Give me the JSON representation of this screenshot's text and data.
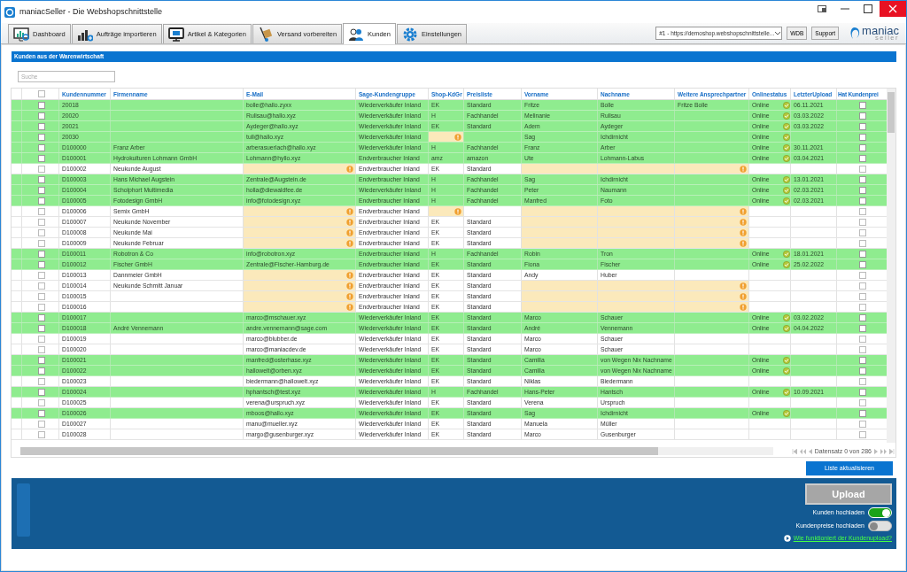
{
  "window": {
    "title": "maniacSeller - Die Webshopschnittstelle"
  },
  "tabs": [
    {
      "label": "Dashboard",
      "selected": false
    },
    {
      "label": "Aufträge importieren",
      "selected": false
    },
    {
      "label": "Artikel & Kategorien",
      "selected": false
    },
    {
      "label": "Versand vorbereiten",
      "selected": false
    },
    {
      "label": "Kunden",
      "selected": true
    },
    {
      "label": "Einstellungen",
      "selected": false
    }
  ],
  "shop_select": {
    "value": "#1 - https://demoshop.webshopschnittstelle..."
  },
  "header_buttons": [
    "WDB",
    "Support"
  ],
  "logo": {
    "name": "maniac",
    "tagline": "seller"
  },
  "section_title": "Kunden aus der Warenwirtschaft",
  "search": {
    "placeholder": "Suche"
  },
  "table": {
    "select_all_checked": false,
    "columns": [
      "Kundennummer",
      "Firmenname",
      "E-Mail",
      "Sage-Kundengruppe",
      "Shop-KdGr",
      "Preisliste",
      "Vorname",
      "Nachname",
      "Weitere Ansprechpartner",
      "Onlinestatus",
      "LetzterUpload",
      "Hat Kundenprei"
    ],
    "rows": [
      {
        "num": "20018",
        "firm": "",
        "email": "bolle@hallo.zyxx",
        "group": "Wiederverkäufer Inland",
        "shop": "EK",
        "price": "Standard",
        "first": "Fritze",
        "last": "Bolle",
        "contact": "Fritze Bolle",
        "online": "Online",
        "upload": "06.11.2021",
        "synced": true,
        "checked": false,
        "has_prices": false,
        "email_warning": false,
        "shop_warning": false,
        "contact_warning": false
      },
      {
        "num": "20020",
        "firm": "",
        "email": "Rulisau@hallo.xyz",
        "group": "Wiederverkäufer Inland",
        "shop": "H",
        "price": "Fachhandel",
        "first": "Melinanie",
        "last": "Rulisau",
        "contact": "",
        "online": "Online",
        "upload": "03.03.2022",
        "synced": true,
        "checked": false,
        "has_prices": false,
        "email_warning": false,
        "shop_warning": false,
        "contact_warning": false
      },
      {
        "num": "20021",
        "firm": "",
        "email": "Aydeger@hallo.xyz",
        "group": "Wiederverkäufer Inland",
        "shop": "EK",
        "price": "Standard",
        "first": "Adem",
        "last": "Aydeger",
        "contact": "",
        "online": "Online",
        "upload": "03.03.2022",
        "synced": true,
        "checked": false,
        "has_prices": false,
        "email_warning": false,
        "shop_warning": false,
        "contact_warning": false
      },
      {
        "num": "20030",
        "firm": "",
        "email": "tull@hallo.xyz",
        "group": "Wiederverkäufer Inland",
        "shop": "",
        "price": "",
        "first": "Sag",
        "last": "Ichdirnicht",
        "contact": "",
        "online": "Online",
        "upload": "",
        "synced": true,
        "checked": false,
        "has_prices": false,
        "email_warning": false,
        "shop_warning": true,
        "contact_warning": false
      },
      {
        "num": "D100000",
        "firm": "Franz Arber",
        "email": "arberasuerlach@hallo.xyz",
        "group": "Wiederverkäufer Inland",
        "shop": "H",
        "price": "Fachhandel",
        "first": "Franz",
        "last": "Arber",
        "contact": "",
        "online": "Online",
        "upload": "30.11.2021",
        "synced": true,
        "checked": false,
        "has_prices": false,
        "email_warning": false,
        "shop_warning": false,
        "contact_warning": false
      },
      {
        "num": "D100001",
        "firm": "Hydrokulturen Lohmann GmbH",
        "email": "Lohmann@hyllo.xyz",
        "group": "Endverbraucher Inland",
        "shop": "amz",
        "price": "amazon",
        "first": "Ute",
        "last": "Lohmann-Labus",
        "contact": "",
        "online": "Online",
        "upload": "03.04.2021",
        "synced": true,
        "checked": false,
        "has_prices": false,
        "email_warning": false,
        "shop_warning": false,
        "contact_warning": false
      },
      {
        "num": "D100002",
        "firm": "Neukunde August",
        "email": "",
        "group": "Endverbraucher Inland",
        "shop": "EK",
        "price": "Standard",
        "first": "",
        "last": "",
        "contact": "",
        "online": "",
        "upload": "",
        "synced": false,
        "checked": false,
        "has_prices": false,
        "email_warning": true,
        "shop_warning": false,
        "contact_warning": true
      },
      {
        "num": "D100003",
        "firm": "Hans Michael Augstein",
        "email": "Zentrale@Augstein.de",
        "group": "Endverbraucher Inland",
        "shop": "H",
        "price": "Fachhandel",
        "first": "Sag",
        "last": "Ichdirnicht",
        "contact": "",
        "online": "Online",
        "upload": "13.01.2021",
        "synced": true,
        "checked": false,
        "has_prices": false,
        "email_warning": false,
        "shop_warning": false,
        "contact_warning": false
      },
      {
        "num": "D100004",
        "firm": "Scholphort Multimedia",
        "email": "holla@diewaldfee.de",
        "group": "Wiederverkäufer Inland",
        "shop": "H",
        "price": "Fachhandel",
        "first": "Peter",
        "last": "Naumann",
        "contact": "",
        "online": "Online",
        "upload": "02.03.2021",
        "synced": true,
        "checked": false,
        "has_prices": false,
        "email_warning": false,
        "shop_warning": false,
        "contact_warning": false
      },
      {
        "num": "D100005",
        "firm": "Fotodesign GmbH",
        "email": "info@fotodesign.xyz",
        "group": "Endverbraucher Inland",
        "shop": "H",
        "price": "Fachhandel",
        "first": "Manfred",
        "last": "Foto",
        "contact": "",
        "online": "Online",
        "upload": "02.03.2021",
        "synced": true,
        "checked": false,
        "has_prices": false,
        "email_warning": false,
        "shop_warning": false,
        "contact_warning": false
      },
      {
        "num": "D100006",
        "firm": "Semix GmbH",
        "email": "",
        "group": "Endverbraucher Inland",
        "shop": "",
        "price": "",
        "first": "",
        "last": "",
        "contact": "",
        "online": "",
        "upload": "",
        "synced": false,
        "checked": false,
        "has_prices": false,
        "email_warning": true,
        "shop_warning": true,
        "contact_warning": true
      },
      {
        "num": "D100007",
        "firm": "Neukunde November",
        "email": "",
        "group": "Endverbraucher Inland",
        "shop": "EK",
        "price": "Standard",
        "first": "",
        "last": "",
        "contact": "",
        "online": "",
        "upload": "",
        "synced": false,
        "checked": false,
        "has_prices": false,
        "email_warning": true,
        "shop_warning": false,
        "contact_warning": true
      },
      {
        "num": "D100008",
        "firm": "Neukunde Mai",
        "email": "",
        "group": "Endverbraucher Inland",
        "shop": "EK",
        "price": "Standard",
        "first": "",
        "last": "",
        "contact": "",
        "online": "",
        "upload": "",
        "synced": false,
        "checked": false,
        "has_prices": false,
        "email_warning": true,
        "shop_warning": false,
        "contact_warning": true
      },
      {
        "num": "D100009",
        "firm": "Neukunde Februar",
        "email": "",
        "group": "Endverbraucher Inland",
        "shop": "EK",
        "price": "Standard",
        "first": "",
        "last": "",
        "contact": "",
        "online": "",
        "upload": "",
        "synced": false,
        "checked": false,
        "has_prices": false,
        "email_warning": true,
        "shop_warning": false,
        "contact_warning": true
      },
      {
        "num": "D100011",
        "firm": "Robotron & Co",
        "email": "info@robotron.xyz",
        "group": "Endverbraucher Inland",
        "shop": "H",
        "price": "Fachhandel",
        "first": "Robin",
        "last": "Tron",
        "contact": "",
        "online": "Online",
        "upload": "18.01.2021",
        "synced": true,
        "checked": false,
        "has_prices": false,
        "email_warning": false,
        "shop_warning": false,
        "contact_warning": false
      },
      {
        "num": "D100012",
        "firm": "Fischer GmbH",
        "email": "Zentrale@Fischer-Hamburg.de",
        "group": "Endverbraucher Inland",
        "shop": "EK",
        "price": "Standard",
        "first": "Fiona",
        "last": "Fischer",
        "contact": "",
        "online": "Online",
        "upload": "25.02.2022",
        "synced": true,
        "checked": false,
        "has_prices": false,
        "email_warning": false,
        "shop_warning": false,
        "contact_warning": false
      },
      {
        "num": "D100013",
        "firm": "Dannmeier GmbH",
        "email": "",
        "group": "Endverbraucher Inland",
        "shop": "EK",
        "price": "Standard",
        "first": "Andy",
        "last": "Huber",
        "contact": "",
        "online": "",
        "upload": "",
        "synced": false,
        "checked": false,
        "has_prices": false,
        "email_warning": true,
        "shop_warning": false,
        "contact_warning": false
      },
      {
        "num": "D100014",
        "firm": "Neukunde Schmitt Januar",
        "email": "",
        "group": "Endverbraucher Inland",
        "shop": "EK",
        "price": "Standard",
        "first": "",
        "last": "",
        "contact": "",
        "online": "",
        "upload": "",
        "synced": false,
        "checked": false,
        "has_prices": false,
        "email_warning": true,
        "shop_warning": false,
        "contact_warning": true
      },
      {
        "num": "D100015",
        "firm": "",
        "email": "",
        "group": "Endverbraucher Inland",
        "shop": "EK",
        "price": "Standard",
        "first": "",
        "last": "",
        "contact": "",
        "online": "",
        "upload": "",
        "synced": false,
        "checked": false,
        "has_prices": false,
        "email_warning": true,
        "shop_warning": false,
        "contact_warning": true
      },
      {
        "num": "D100016",
        "firm": "",
        "email": "",
        "group": "Endverbraucher Inland",
        "shop": "EK",
        "price": "Standard",
        "first": "",
        "last": "",
        "contact": "",
        "online": "",
        "upload": "",
        "synced": false,
        "checked": false,
        "has_prices": false,
        "email_warning": true,
        "shop_warning": false,
        "contact_warning": true
      },
      {
        "num": "D100017",
        "firm": "",
        "email": "marco@mschauer.xyz",
        "group": "Wiederverkäufer Inland",
        "shop": "EK",
        "price": "Standard",
        "first": "Marco",
        "last": "Schauer",
        "contact": "",
        "online": "Online",
        "upload": "03.02.2022",
        "synced": true,
        "checked": false,
        "has_prices": false,
        "email_warning": false,
        "shop_warning": false,
        "contact_warning": false
      },
      {
        "num": "D100018",
        "firm": "André Vennemann",
        "email": "andre.vennemann@sage.com",
        "group": "Wiederverkäufer Inland",
        "shop": "EK",
        "price": "Standard",
        "first": "André",
        "last": "Vennemann",
        "contact": "",
        "online": "Online",
        "upload": "04.04.2022",
        "synced": true,
        "checked": false,
        "has_prices": false,
        "email_warning": false,
        "shop_warning": false,
        "contact_warning": false
      },
      {
        "num": "D100019",
        "firm": "",
        "email": "marco@blubber.de",
        "group": "Wiederverkäufer Inland",
        "shop": "EK",
        "price": "Standard",
        "first": "Marco",
        "last": "Schauer",
        "contact": "",
        "online": "",
        "upload": "",
        "synced": false,
        "checked": false,
        "has_prices": false,
        "email_warning": false,
        "shop_warning": false,
        "contact_warning": false
      },
      {
        "num": "D100020",
        "firm": "",
        "email": "marco@maniacdev.de",
        "group": "Wiederverkäufer Inland",
        "shop": "EK",
        "price": "Standard",
        "first": "Marco",
        "last": "Schauer",
        "contact": "",
        "online": "",
        "upload": "",
        "synced": false,
        "checked": false,
        "has_prices": false,
        "email_warning": false,
        "shop_warning": false,
        "contact_warning": false
      },
      {
        "num": "D100021",
        "firm": "",
        "email": "manfred@osterhase.xyz",
        "group": "Wiederverkäufer Inland",
        "shop": "EK",
        "price": "Standard",
        "first": "Camilla",
        "last": "von Wegen Nix Nachname",
        "contact": "",
        "online": "Online",
        "upload": "",
        "synced": true,
        "checked": false,
        "has_prices": false,
        "email_warning": false,
        "shop_warning": false,
        "contact_warning": false
      },
      {
        "num": "D100022",
        "firm": "",
        "email": "hallowelt@orben.xyz",
        "group": "Wiederverkäufer Inland",
        "shop": "EK",
        "price": "Standard",
        "first": "Camilla",
        "last": "von Wegen Nix Nachname",
        "contact": "",
        "online": "Online",
        "upload": "",
        "synced": true,
        "checked": false,
        "has_prices": false,
        "email_warning": false,
        "shop_warning": false,
        "contact_warning": false
      },
      {
        "num": "D100023",
        "firm": "",
        "email": "biedermann@hallowelt.xyz",
        "group": "Wiederverkäufer Inland",
        "shop": "EK",
        "price": "Standard",
        "first": "Niklas",
        "last": "Biedermann",
        "contact": "",
        "online": "",
        "upload": "",
        "synced": false,
        "checked": false,
        "has_prices": false,
        "email_warning": false,
        "shop_warning": false,
        "contact_warning": false
      },
      {
        "num": "D100024",
        "firm": "",
        "email": "hphantsch@test.xyz",
        "group": "Wiederverkäufer Inland",
        "shop": "H",
        "price": "Fachhandel",
        "first": "Hans-Peter",
        "last": "Hantsch",
        "contact": "",
        "online": "Online",
        "upload": "10.09.2021",
        "synced": true,
        "checked": false,
        "has_prices": false,
        "email_warning": false,
        "shop_warning": false,
        "contact_warning": false
      },
      {
        "num": "D100025",
        "firm": "",
        "email": "verena@urspruch.xyz",
        "group": "Wiederverkäufer Inland",
        "shop": "EK",
        "price": "Standard",
        "first": "Verena",
        "last": "Urspruch",
        "contact": "",
        "online": "",
        "upload": "",
        "synced": false,
        "checked": false,
        "has_prices": false,
        "email_warning": false,
        "shop_warning": false,
        "contact_warning": false
      },
      {
        "num": "D100026",
        "firm": "",
        "email": "mboos@hallo.xyz",
        "group": "Wiederverkäufer Inland",
        "shop": "EK",
        "price": "Standard",
        "first": "Sag",
        "last": "Ichdirnicht",
        "contact": "",
        "online": "Online",
        "upload": "",
        "synced": true,
        "checked": false,
        "has_prices": false,
        "email_warning": false,
        "shop_warning": false,
        "contact_warning": false
      },
      {
        "num": "D100027",
        "firm": "",
        "email": "manu@mueller.xyz",
        "group": "Wiederverkäufer Inland",
        "shop": "EK",
        "price": "Standard",
        "first": "Manuela",
        "last": "Müller",
        "contact": "",
        "online": "",
        "upload": "",
        "synced": false,
        "checked": false,
        "has_prices": false,
        "email_warning": false,
        "shop_warning": false,
        "contact_warning": false
      },
      {
        "num": "D100028",
        "firm": "",
        "email": "margo@gusenburger.xyz",
        "group": "Wiederverkäufer Inland",
        "shop": "EK",
        "price": "Standard",
        "first": "Marco",
        "last": "Gusenburger",
        "contact": "",
        "online": "",
        "upload": "",
        "synced": false,
        "checked": false,
        "has_prices": false,
        "email_warning": false,
        "shop_warning": false,
        "contact_warning": false
      }
    ]
  },
  "pager": {
    "text": "Datensatz 0 von 286"
  },
  "refresh_button": "Liste aktualisieren",
  "upload": {
    "button": {
      "label": "Upload",
      "disabled": true
    },
    "toggles": [
      {
        "label": "Kunden hochladen",
        "on": true
      },
      {
        "label": "Kundenpreise hochladen",
        "on": false
      }
    ],
    "help_link": "Wie funktioniert der Kundenupload?"
  }
}
